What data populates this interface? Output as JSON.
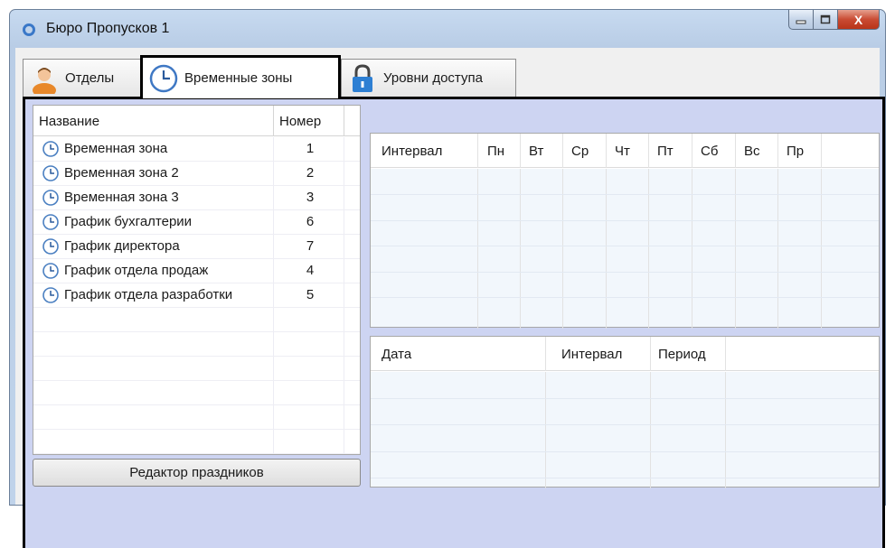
{
  "window": {
    "title": "Бюро Пропусков 1",
    "close_glyph": "X"
  },
  "tabs": [
    {
      "label": "Отделы",
      "icon": "user-icon"
    },
    {
      "label": "Временные зоны",
      "icon": "clock-icon",
      "active": true
    },
    {
      "label": "Уровни доступа",
      "icon": "lock-icon"
    }
  ],
  "zones_table": {
    "columns": {
      "name": "Название",
      "number": "Номер"
    },
    "rows": [
      {
        "name": "Временная зона",
        "number": "1"
      },
      {
        "name": "Временная зона 2",
        "number": "2"
      },
      {
        "name": "Временная зона 3",
        "number": "3"
      },
      {
        "name": "График бухгалтерии",
        "number": "6"
      },
      {
        "name": "График директора",
        "number": "7"
      },
      {
        "name": "График отдела продаж",
        "number": "4"
      },
      {
        "name": "График отдела разработки",
        "number": "5"
      }
    ]
  },
  "holiday_button": {
    "label": "Редактор праздников"
  },
  "interval_grid": {
    "columns": [
      "Интервал",
      "Пн",
      "Вт",
      "Ср",
      "Чт",
      "Пт",
      "Сб",
      "Вс",
      "Пр"
    ]
  },
  "date_grid": {
    "columns": [
      "Дата",
      "Интервал",
      "Период"
    ]
  },
  "colors": {
    "panel_bg": "#cdd4f2",
    "grid_body": "#f2f7fc",
    "close_button": "#c94b33",
    "active_tab_border": "#000000"
  }
}
